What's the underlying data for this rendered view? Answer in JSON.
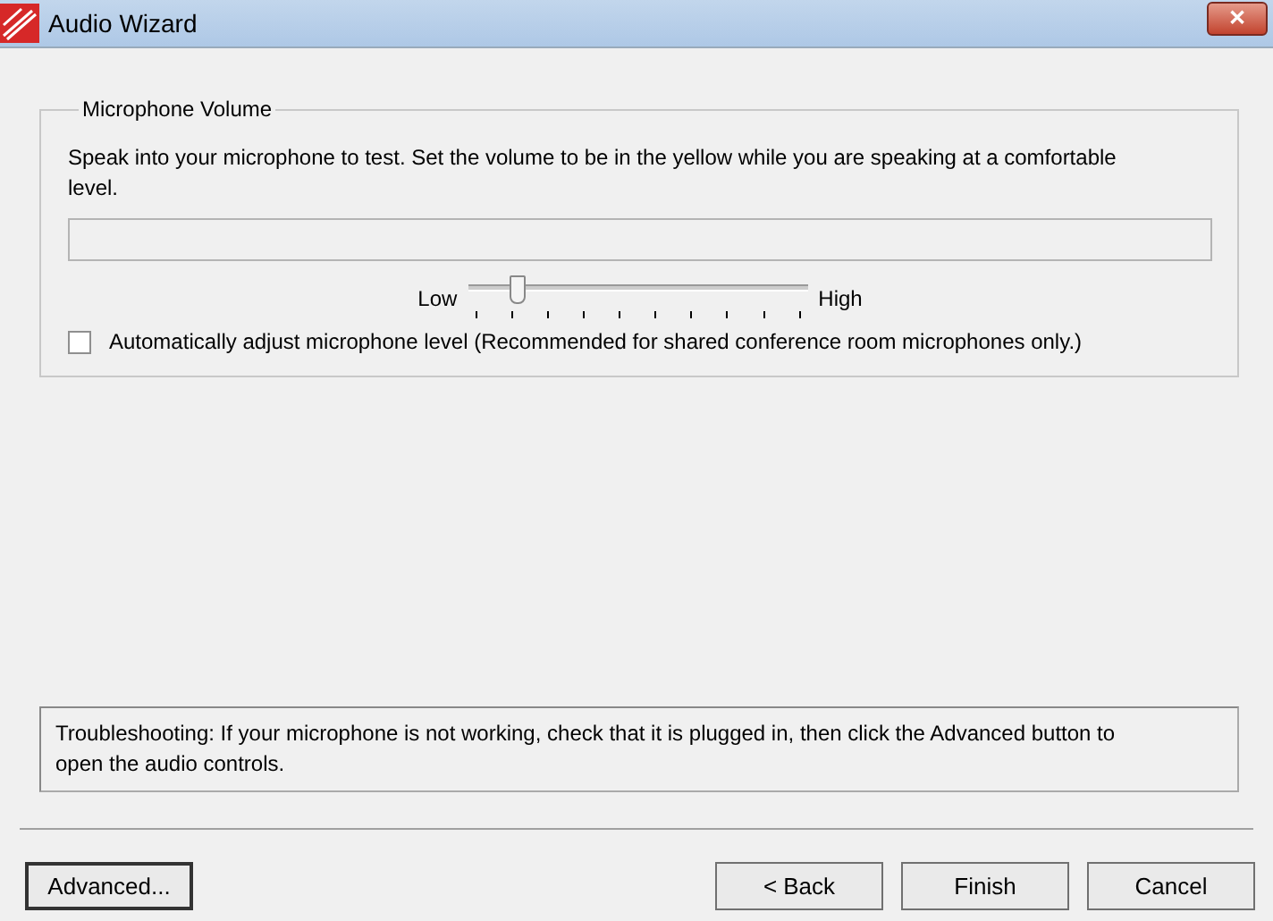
{
  "window": {
    "title": "Audio Wizard",
    "close": "✕"
  },
  "microphone_volume": {
    "title": "Microphone Volume",
    "instructions": "Speak into your microphone to test. Set the volume to be in the yellow while you are speaking at a comfortable level.",
    "slider": {
      "low_label": "Low",
      "high_label": "High",
      "level": 0.15
    },
    "auto_adjust": {
      "label": "Automatically adjust microphone level (Recommended for shared conference room microphones only.)",
      "checked": false
    }
  },
  "troubleshooting": "Troubleshooting: If your microphone is not working, check that it is plugged in, then click the Advanced button to open the audio controls.",
  "buttons": [
    {
      "label": "Advanced...",
      "kind": "left"
    },
    {
      "label": "< Back",
      "kind": "right"
    },
    {
      "label": "Finish",
      "kind": "right"
    },
    {
      "label": "Cancel",
      "kind": "right"
    }
  ]
}
